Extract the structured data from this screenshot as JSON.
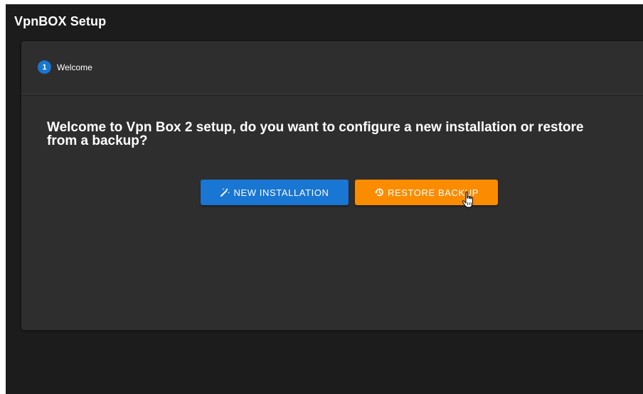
{
  "app": {
    "title": "VpnBOX Setup"
  },
  "stepper": {
    "steps": [
      {
        "number": "1",
        "label": "Welcome"
      }
    ]
  },
  "welcome": {
    "question": "Welcome to Vpn Box 2 setup, do you want to configure a new installation or restore from a backup?"
  },
  "actions": {
    "new_installation": {
      "label": "NEW INSTALLATION",
      "icon": "magic-wand-icon",
      "color": "#1976d2"
    },
    "restore_backup": {
      "label": "RESTORE BACKUP",
      "icon": "restore-icon",
      "color": "#fb8c00"
    }
  },
  "cursor": {
    "icon": "hand-pointer-icon"
  }
}
